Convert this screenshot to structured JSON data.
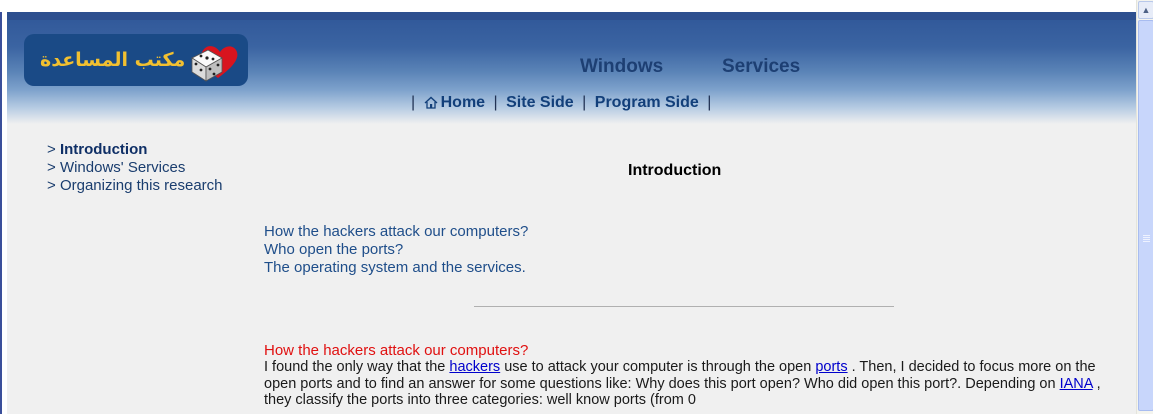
{
  "logo": {
    "text": "مكتب المساعدة"
  },
  "header": {
    "title_left": "Windows",
    "title_right": "Services"
  },
  "nav": {
    "items": [
      {
        "label": "Home"
      },
      {
        "label": "Site Side"
      },
      {
        "label": "Program Side"
      }
    ],
    "separator": "|"
  },
  "sidebar": {
    "prefix": ">",
    "items": [
      {
        "label": "Introduction",
        "active": true
      },
      {
        "label": "Windows' Services"
      },
      {
        "label": "Organizing this research"
      }
    ]
  },
  "main": {
    "title": "Introduction",
    "toc": [
      "How the hackers attack our computers?",
      "Who open the ports?",
      "The operating system and the services."
    ],
    "section_heading": "How the hackers attack our computers?",
    "para": {
      "t1": "I found the only way that the ",
      "link_hackers": "hackers",
      "t2": " use to attack your computer is through the open ",
      "link_ports": "ports",
      "t3": " . Then, I decided to focus more on the open ports and to find an answer for some questions like: Why does this port open? Who did open this port?. Depending on ",
      "link_iana": "IANA",
      "t4": " , they classify the ports into three categories: well know ports (from 0"
    }
  },
  "colors": {
    "header_dark": "#2f5698",
    "logo_gold": "#f2c030",
    "link": "#0000cc",
    "heading_red": "#e01010"
  }
}
